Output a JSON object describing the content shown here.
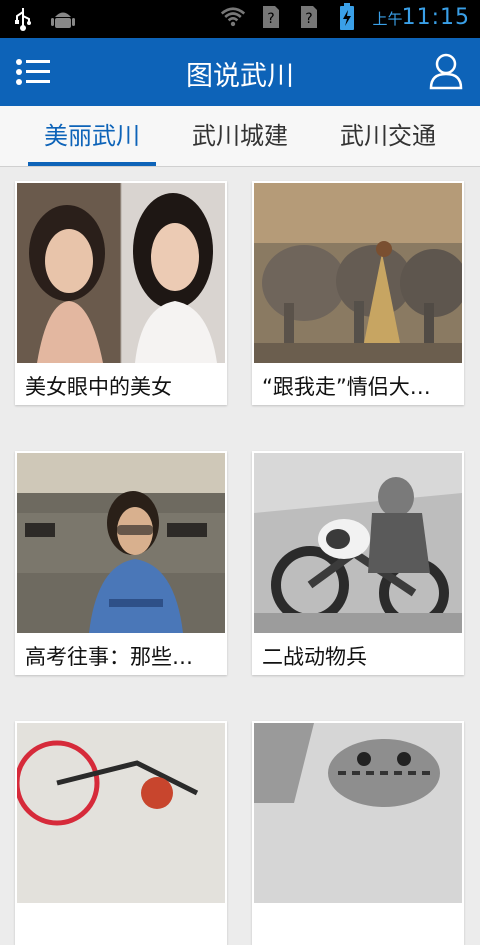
{
  "status_bar": {
    "time": "11:15",
    "ampm": "上午",
    "icons": [
      "usb-icon",
      "android-debug-icon",
      "wifi-icon",
      "no-sim-icon",
      "no-sim-icon",
      "battery-charging-icon"
    ]
  },
  "app_bar": {
    "title": "图说武川",
    "menu_icon": "menu-list-icon",
    "user_icon": "user-icon"
  },
  "tabs": [
    {
      "label": "美丽武川",
      "active": true
    },
    {
      "label": "武川城建",
      "active": false
    },
    {
      "label": "武川交通",
      "active": false
    }
  ],
  "cards": [
    {
      "caption": "美女眼中的美女"
    },
    {
      "caption": "“跟我走”情侣大…"
    },
    {
      "caption": "高考往事：那些…"
    },
    {
      "caption": "二战动物兵"
    },
    {
      "caption": ""
    },
    {
      "caption": ""
    }
  ],
  "colors": {
    "primary": "#0d63b8",
    "accent_time": "#3aa0e8",
    "background": "#ececec"
  }
}
